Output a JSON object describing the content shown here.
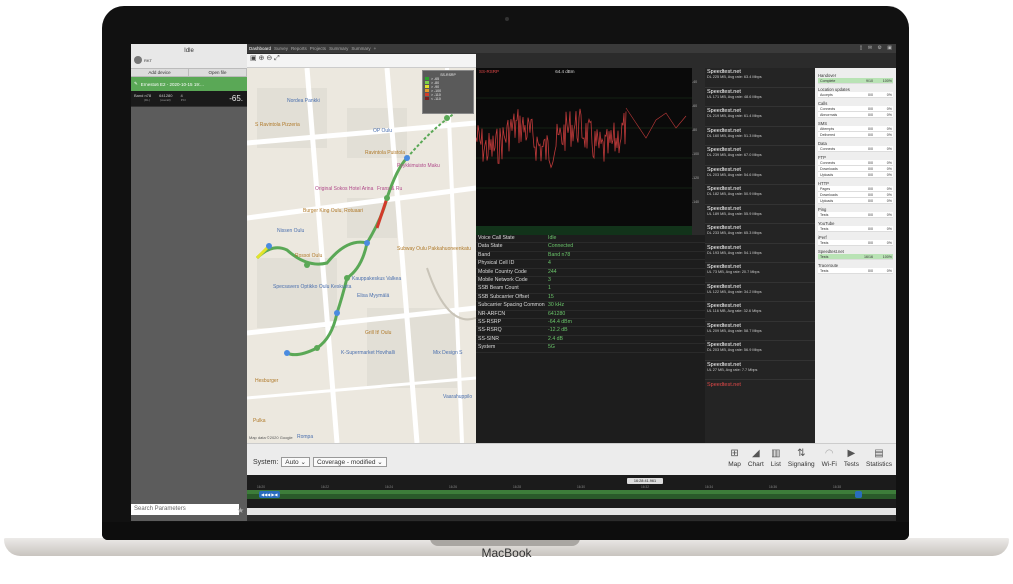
{
  "device": {
    "brand": "MacBook"
  },
  "sidebar": {
    "username": "Idle",
    "user_sub": "RKT",
    "add_device_label": "Add device",
    "open_file_label": "Open file",
    "device_name": "Ernesto6 E2 - 2020-10-15 19:...",
    "band_label": "Band n78",
    "channel": "641280",
    "count": "4",
    "channel_sub": "(DL)",
    "count_sub": "(overall)",
    "pci_sub": "PCI",
    "rsrp_value": "-65.",
    "search_placeholder": "Search Parameters"
  },
  "tabs": [
    "Dashboard",
    "Survey",
    "Reports",
    "Projects",
    "Summary",
    "Summary"
  ],
  "map": {
    "places": [
      "Nordea Pankki",
      "S Ravintola Pizzeria",
      "OP Oulu",
      "Ravintola Puistola",
      "Pyykkimuisto Maku",
      "Original Sokos Hotel Arina",
      "Frans & Ru",
      "Burger King Oulu, Rotuaari",
      "Nissen Oulu",
      "Rossoi Oulu",
      "Subway Oulu Pakkahuoneenkatu",
      "Kauppakeskus Valkea",
      "Elisa Myymälä",
      "Specsavers Optikko Oulu Keskusta",
      "Grill It! Oulu",
      "K-Supermarket Hovihalli",
      "Hesburger",
      "Mix Design S",
      "Vaarahuppilo",
      "Pulka",
      "Rompa"
    ],
    "copyright": "Map data ©2020 Google",
    "legend": {
      "title": "SS-RSRP",
      "ranges": [
        "> -65",
        "> -80",
        "> -90",
        "> -100",
        "> -110",
        "< -110"
      ],
      "colors": [
        "#2ea12e",
        "#7bd14a",
        "#e3e32a",
        "#e39a2a",
        "#d43d2a",
        "#7a1f1f"
      ]
    }
  },
  "chart": {
    "header_label": "SS-RSRP",
    "header_value": "64.4 dBm",
    "ticks": [
      "-40",
      "-60",
      "-80",
      "-100",
      "-120",
      "-140"
    ]
  },
  "info": {
    "keys": [
      "Voice Call State",
      "Data State",
      "Band",
      "Physical Cell ID",
      "Mobile Country Code",
      "Mobile Network Code",
      "SSB Beam Count",
      "SSB Subcarrier Offset",
      "Subcarrier Spacing Common",
      "NR-ARFCN",
      "SS-RSRP",
      "SS-RSRQ",
      "SS-SINR",
      "System"
    ],
    "values": [
      "Idle",
      "Connected",
      "Band n78",
      "4",
      "244",
      "3",
      "1",
      "15",
      "30 kHz",
      "641280",
      "-64.4 dBm",
      "-12.2 dB",
      "2.4 dB",
      "5G"
    ]
  },
  "speedtest": {
    "title": "Speedtest.net",
    "entries": [
      "DL 225 MB, Avg rate: 63.4 Mbps",
      "UL 171 MB, Avg rate: 48.6 Mbps",
      "DL 219 MB, Avg rate: 61.4 Mbps",
      "DL 160 MB, Avg rate: 51.3 Mbps",
      "DL 239 MB, Avg rate: 67.0 Mbps",
      "DL 203 MB, Avg rate: 54.6 Mbps",
      "DL 182 MB, Avg rate: 50.9 Mbps",
      "UL 189 MB, Avg rate: 55.9 Mbps",
      "DL 233 MB, Avg rate: 65.3 Mbps",
      "DL 193 MB, Avg rate: 54.1 Mbps",
      "UL 73 MB, Avg rate: 20.7 Mbps",
      "UL 122 MB, Avg rate: 34.2 Mbps",
      "UL 116 MB, Avg rate: 32.6 Mbps",
      "UL 209 MB, Avg rate: 58.7 Mbps",
      "DL 203 MB, Avg rate: 56.9 Mbps",
      "UL 27 MB, Avg rate: 7.7 Mbps"
    ],
    "last": "Speedtest.net"
  },
  "stats": {
    "groups": [
      {
        "name": "Handover",
        "rows": [
          [
            "Complete",
            "9/10",
            "100%"
          ]
        ],
        "green": [
          true
        ]
      },
      {
        "name": "Location updates",
        "rows": [
          [
            "Accepts",
            "0/0",
            "0%"
          ]
        ],
        "green": [
          false
        ]
      },
      {
        "name": "Calls",
        "rows": [
          [
            "Connects",
            "0/0",
            "0%"
          ],
          [
            "Abnormals",
            "0/0",
            "0%"
          ]
        ],
        "green": [
          false,
          false
        ]
      },
      {
        "name": "SMS",
        "rows": [
          [
            "Attempts",
            "0/0",
            "0%"
          ],
          [
            "Delivered",
            "0/0",
            "0%"
          ]
        ],
        "green": [
          false,
          false
        ]
      },
      {
        "name": "Data",
        "rows": [
          [
            "Connects",
            "0/0",
            "0%"
          ]
        ],
        "green": [
          false
        ]
      },
      {
        "name": "FTP",
        "rows": [
          [
            "Connects",
            "0/0",
            "0%"
          ],
          [
            "Downloads",
            "0/0",
            "0%"
          ],
          [
            "Uploads",
            "0/0",
            "0%"
          ]
        ],
        "green": [
          false,
          false,
          false
        ]
      },
      {
        "name": "HTTP",
        "rows": [
          [
            "Pages",
            "0/0",
            "0%"
          ],
          [
            "Downloads",
            "0/0",
            "0%"
          ],
          [
            "Uploads",
            "0/0",
            "0%"
          ]
        ],
        "green": [
          false,
          false,
          false
        ]
      },
      {
        "name": "Ping",
        "rows": [
          [
            "Tests",
            "0/0",
            "0%"
          ]
        ],
        "green": [
          false
        ]
      },
      {
        "name": "YouTube",
        "rows": [
          [
            "Tests",
            "0/0",
            "0%"
          ]
        ],
        "green": [
          false
        ]
      },
      {
        "name": "iPerf",
        "rows": [
          [
            "Tests",
            "0/0",
            "0%"
          ]
        ],
        "green": [
          false
        ]
      },
      {
        "name": "Speedtest.net",
        "rows": [
          [
            "Tests",
            "16/16",
            "100%"
          ]
        ],
        "green": [
          true
        ]
      },
      {
        "name": "Traceroute",
        "rows": [
          [
            "Tests",
            "0/0",
            "0%"
          ]
        ],
        "green": [
          false
        ]
      }
    ]
  },
  "bottom": {
    "system_label": "System:",
    "system_value": "Auto",
    "coverage_value": "Coverage - modified",
    "tools": [
      "Map",
      "Chart",
      "List",
      "Signaling",
      "Wi-Fi",
      "Tests",
      "Statistics"
    ]
  },
  "timeline": {
    "cursor_time": "16:28:41.961",
    "ticks": [
      "16:20",
      "16:22",
      "16:24",
      "16:26",
      "16:28",
      "16:30",
      "16:32",
      "16:34",
      "16:36",
      "16:38"
    ]
  },
  "colors": {
    "accent_green": "#5aa856",
    "panel_dark": "#1d1d1d",
    "value_green": "#6bc66b"
  }
}
